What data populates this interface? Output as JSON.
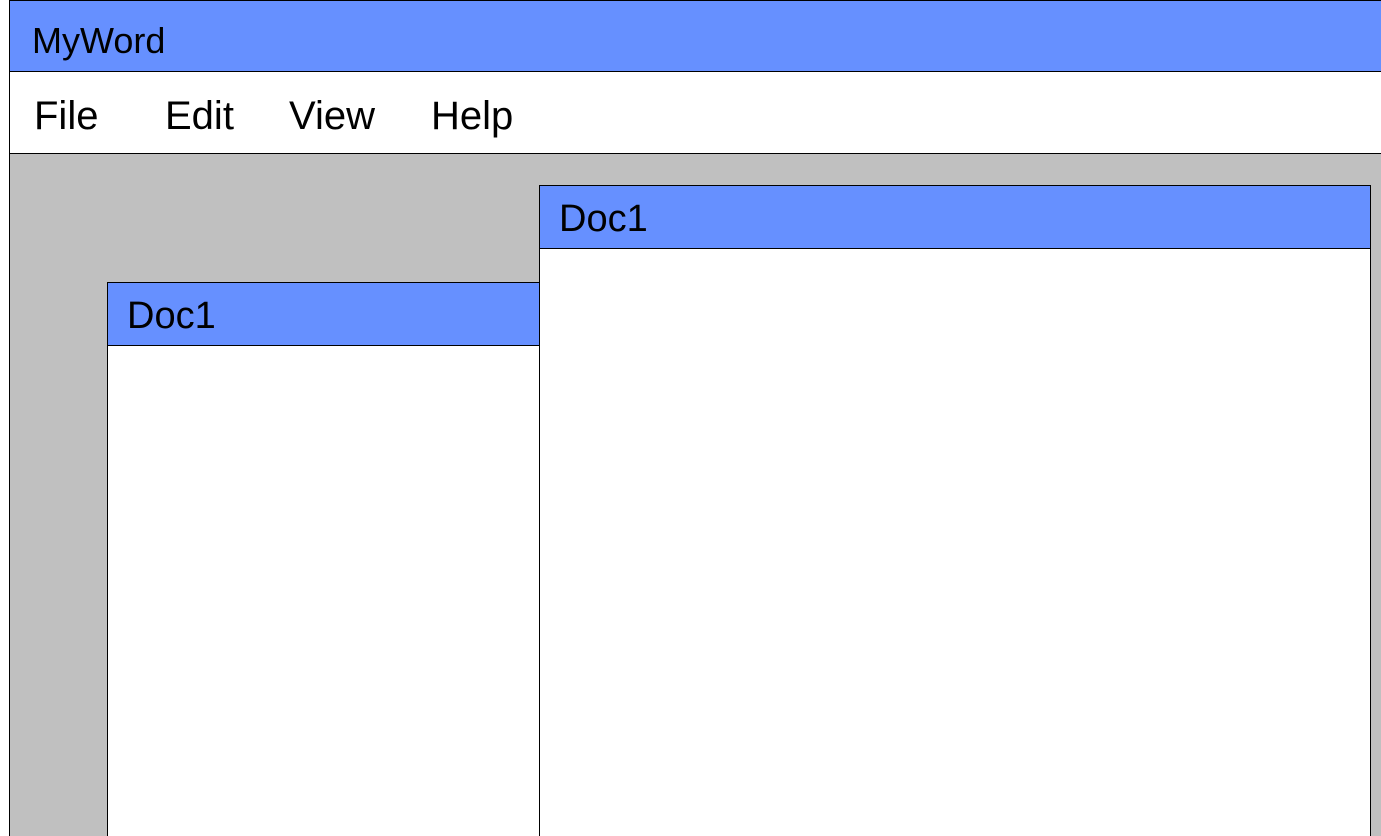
{
  "app": {
    "title": "MyWord",
    "accent_color": "#6690ff",
    "workspace_color": "#c0c0c0"
  },
  "menubar": {
    "items": [
      {
        "label": "File"
      },
      {
        "label": "Edit"
      },
      {
        "label": "View"
      },
      {
        "label": "Help"
      }
    ]
  },
  "documents": [
    {
      "title": "Doc1"
    },
    {
      "title": "Doc1"
    }
  ]
}
